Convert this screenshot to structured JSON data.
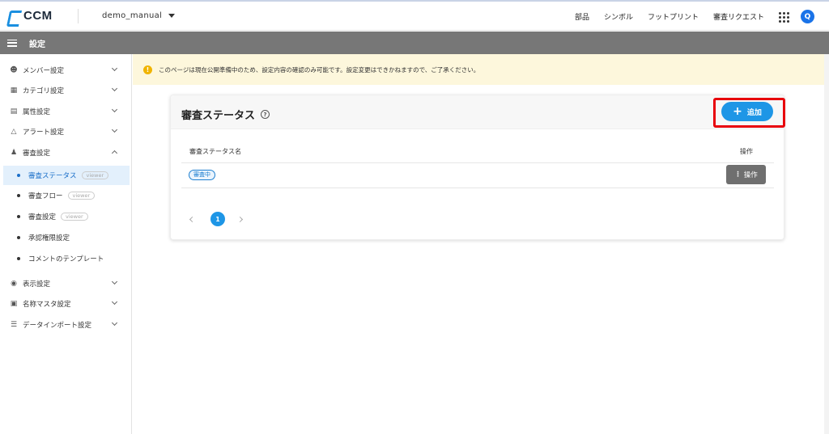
{
  "header": {
    "logo_text": "CCM",
    "project": "demo_manual",
    "nav": [
      "部品",
      "シンボル",
      "フットプリント",
      "審査リクエスト"
    ],
    "avatar_letter": "Q"
  },
  "titlebar": {
    "title": "設定"
  },
  "sidebar": {
    "items": [
      {
        "label": "メンバー設定",
        "icon": "user-icon"
      },
      {
        "label": "カテゴリ設定",
        "icon": "category-icon"
      },
      {
        "label": "属性設定",
        "icon": "attribute-icon"
      },
      {
        "label": "アラート設定",
        "icon": "bell-icon"
      },
      {
        "label": "審査設定",
        "icon": "review-icon"
      },
      {
        "label": "表示設定",
        "icon": "eye-icon"
      },
      {
        "label": "名称マスタ設定",
        "icon": "master-icon"
      },
      {
        "label": "データインポート設定",
        "icon": "database-icon"
      }
    ],
    "sub": [
      {
        "label": "審査ステータス",
        "badge": "viewer"
      },
      {
        "label": "審査フロー",
        "badge": "viewer"
      },
      {
        "label": "審査設定",
        "badge": "viewer"
      },
      {
        "label": "承認権限設定",
        "badge": ""
      },
      {
        "label": "コメントのテンプレート",
        "badge": ""
      }
    ]
  },
  "notice": {
    "text": "このページは現在公開準備中のため、設定内容の確認のみ可能です。設定変更はできかねますので、ご了承ください。"
  },
  "card": {
    "title": "審査ステータス",
    "help": "?",
    "add_label": "追加",
    "columns": [
      "審査ステータス名",
      "操作"
    ],
    "rows": [
      {
        "status": "審査中",
        "action": "操作"
      }
    ],
    "page": "1"
  },
  "colors": {
    "accent": "#1e96e6",
    "highlight": "#e8000b",
    "notice_bg": "#fdf7dc"
  }
}
